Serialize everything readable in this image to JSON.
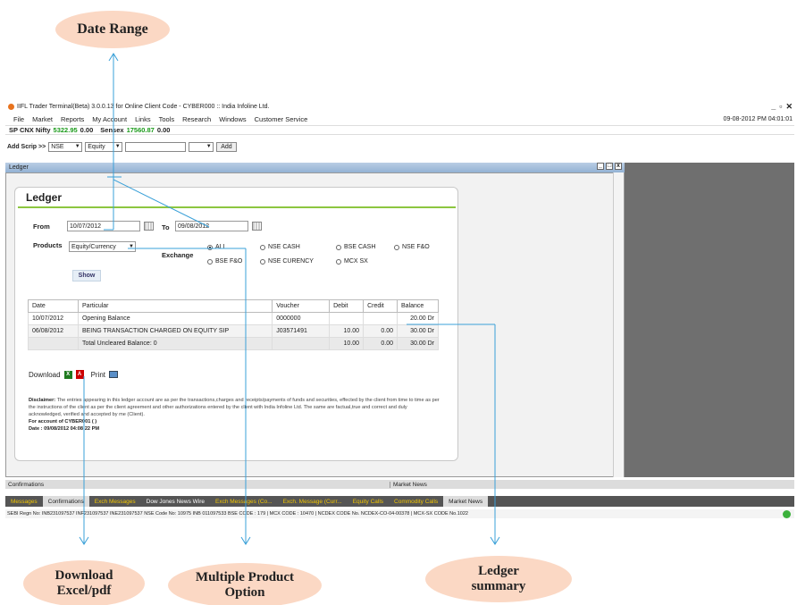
{
  "annotations": {
    "date_range": "Date Range",
    "download": "Download Excel/pdf",
    "multiple_product": "Multiple Product Option",
    "ledger_summary": "Ledger summary",
    "callout_color": "#fbd8c4"
  },
  "app": {
    "title": "IIFL Trader Terminal(Beta) 3.0.0.13 for Online Client Code - CYBER000 :: India Infoline Ltd.",
    "menu": [
      "File",
      "Market",
      "Reports",
      "My Account",
      "Links",
      "Tools",
      "Research",
      "Windows",
      "Customer Service"
    ],
    "datetime": "09-08-2012 PM 04:01:01",
    "ticker": {
      "nifty_label": "SP CNX Nifty",
      "nifty_value": "5322.95",
      "nifty_change": "0.00",
      "sensex_label": "Sensex",
      "sensex_value": "17560.87",
      "sensex_change": "0.00"
    },
    "addscrip": {
      "label": "Add Scrip >>",
      "exchange": "NSE",
      "segment": "Equity",
      "add_label": "Add"
    }
  },
  "ledger_window": {
    "title": "Ledger",
    "heading": "Ledger",
    "from_label": "From",
    "from_value": "10/07/2012",
    "to_label": "To",
    "to_value": "09/08/2012",
    "products_label": "Products",
    "products_value": "Equity/Currency",
    "exchange_label": "Exchange",
    "exchange_options": [
      "ALL",
      "NSE CASH",
      "BSE CASH",
      "NSE F&O",
      "BSE F&O",
      "NSE CURENCY",
      "MCX SX"
    ],
    "exchange_selected": "ALL",
    "show_label": "Show",
    "table": {
      "headers": [
        "Date",
        "Particular",
        "Voucher",
        "Debit",
        "Credit",
        "Balance"
      ],
      "rows": [
        [
          "10/07/2012",
          "Opening Balance",
          "0000000",
          "",
          "",
          "20.00 Dr"
        ],
        [
          "06/08/2012",
          "BEING TRANSACTION CHARGED ON EQUITY SIP",
          "J03571491",
          "10.00",
          "0.00",
          "30.00 Dr"
        ],
        [
          "",
          "Total Uncleared Balance: 0",
          "",
          "10.00",
          "0.00",
          "30.00 Dr"
        ]
      ]
    },
    "download_label": "Download",
    "print_label": "Print",
    "disclaimer_title": "Disclaimer:",
    "disclaimer_text": "The entries appearing in this ledger account are as per the transactions,charges and receipts/payments of funds and securities, effected by the client from time to time as per the instructions of the client as per the client agreement and other authorizations entered by the client with India Infoline Ltd. The same are factual,true and correct and duly acknowledged, verified and accepted by me (Client).",
    "account_line": "For account of CYBER001 ( )",
    "date_line": "Date : 09/08/2012 04:08:22 PM"
  },
  "bottom": {
    "confirmations": "Confirmations",
    "market_news": "Market News",
    "tabs": [
      "Messages",
      "Confirmations",
      "Exch Messages",
      "Dow Jones News Wire",
      "Exch Messages (Co...",
      "Exch. Message (Curr...",
      "Equity Calls",
      "Commodity Calls",
      "Market News"
    ],
    "sebi": "SEBI Regn No: INB231097537  INF231097537  INE231097537  NSE Code No: 10975  INB 011097533 BSE CODE : 179 | MCX CODE : 10470 | NCDEX CODE No. NCDEX-CO-04-00378 | MCX-SX CODE No.1022"
  }
}
